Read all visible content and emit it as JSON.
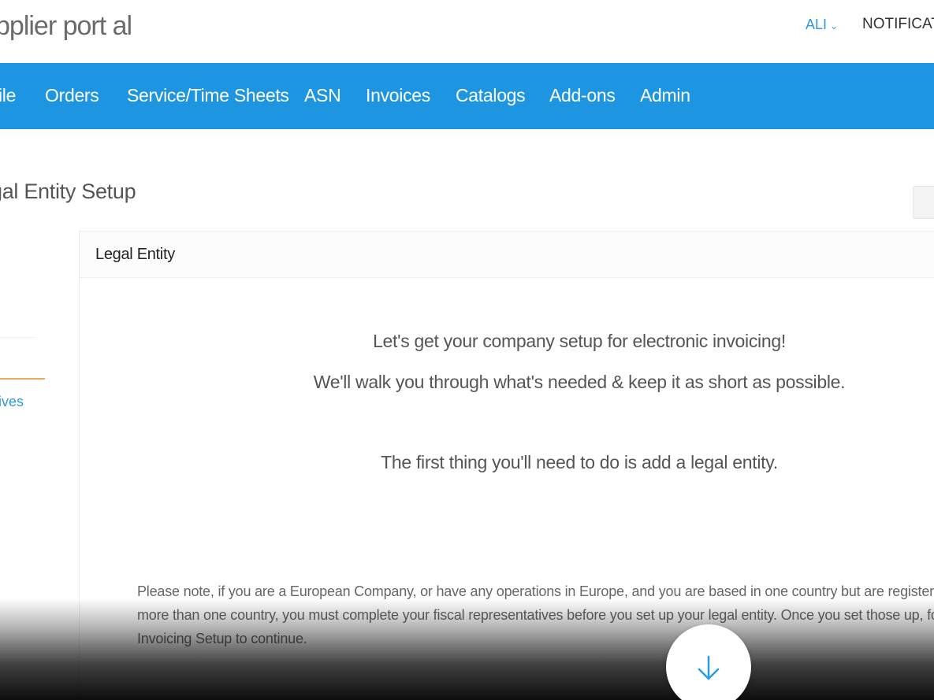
{
  "header": {
    "logo_text": "pplier port al",
    "user_label": "ALI",
    "notifications_label": "NOTIFICATI"
  },
  "nav": {
    "items": [
      {
        "label": "ile"
      },
      {
        "label": "Orders"
      },
      {
        "label": "Service/Time Sheets"
      },
      {
        "label": "ASN"
      },
      {
        "label": "Invoices"
      },
      {
        "label": "Catalogs"
      },
      {
        "label": "Add-ons"
      },
      {
        "label": "Admin"
      }
    ]
  },
  "page": {
    "title": "gal Entity Setup"
  },
  "sidebar": {
    "link_fragment": "ives"
  },
  "panel": {
    "title": "Legal Entity",
    "line1": "Let's get your company setup for electronic invoicing!",
    "line2": "We'll walk you through what's needed & keep it as short as possible.",
    "line3": "The first thing you'll need to do is add a legal entity.",
    "note_line1": "Please note, if you are a European Company, or have any operations in Europe, and you are based in one country but are registered",
    "note_line2": "more than one country, you must complete your fiscal representatives before you set up your legal entity. Once you set those up, follo",
    "note_line3": "Invoicing Setup to continue."
  },
  "colors": {
    "nav_bg": "#1e95e0",
    "link": "#2b9be0",
    "accent_divider": "#f0a860"
  },
  "icons": {
    "user_chevron": "chevron-down-icon",
    "scroll": "arrow-down-icon"
  }
}
